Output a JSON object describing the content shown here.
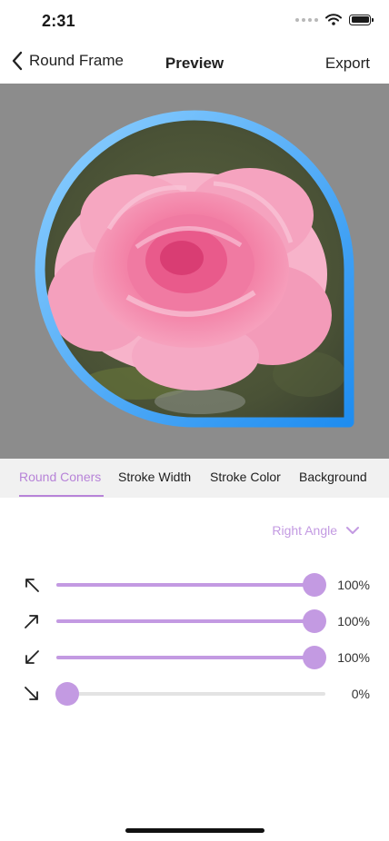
{
  "status_bar": {
    "time": "2:31",
    "icons": [
      "cellular-dots-icon",
      "wifi-icon",
      "battery-icon"
    ]
  },
  "nav": {
    "back_label": "Round Frame",
    "title": "Preview",
    "export_label": "Export",
    "back_icon": "chevron-left-icon"
  },
  "preview": {
    "frame_colors": [
      "#8fd0ff",
      "#1f8df0"
    ],
    "background_color": "#8c8c8c"
  },
  "tabs": [
    {
      "label": "Round Coners",
      "active": true
    },
    {
      "label": "Stroke Width",
      "active": false
    },
    {
      "label": "Stroke Color",
      "active": false
    },
    {
      "label": "Background",
      "active": false
    }
  ],
  "corner_select": {
    "label": "Right Angle",
    "icon": "chevron-down-icon"
  },
  "sliders": [
    {
      "icon": "arrow-up-left-icon",
      "value": 1.0,
      "value_label": "100%"
    },
    {
      "icon": "arrow-up-right-icon",
      "value": 1.0,
      "value_label": "100%"
    },
    {
      "icon": "arrow-down-left-icon",
      "value": 1.0,
      "value_label": "100%"
    },
    {
      "icon": "arrow-down-right-icon",
      "value": 0.0,
      "value_label": "0%"
    }
  ],
  "colors": {
    "accent": "#c39ae2",
    "accent_dark": "#b783d8",
    "track": "#e3e3e3"
  }
}
